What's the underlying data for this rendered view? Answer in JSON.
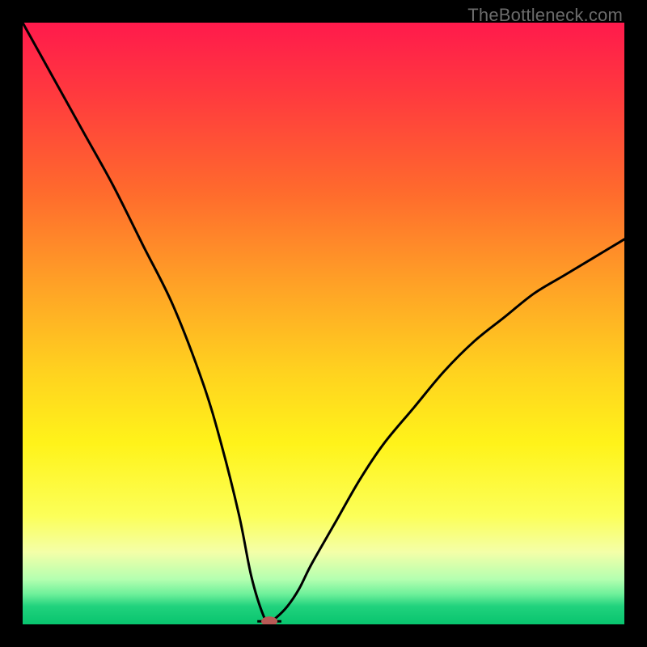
{
  "watermark": "TheBottleneck.com",
  "chart_data": {
    "type": "line",
    "title": "",
    "xlabel": "",
    "ylabel": "",
    "xlim": [
      0,
      100
    ],
    "ylim": [
      0,
      100
    ],
    "series": [
      {
        "name": "bottleneck-curve",
        "x": [
          0,
          5,
          10,
          15,
          20,
          25,
          30,
          33,
          36,
          38,
          40,
          41,
          42,
          44,
          46,
          48,
          52,
          56,
          60,
          65,
          70,
          75,
          80,
          85,
          90,
          95,
          100
        ],
        "values": [
          100,
          91,
          82,
          73,
          63,
          53,
          40,
          30,
          18,
          8,
          1.5,
          0.5,
          1,
          3,
          6,
          10,
          17,
          24,
          30,
          36,
          42,
          47,
          51,
          55,
          58,
          61,
          64
        ]
      }
    ],
    "marker": {
      "x": 41,
      "y": 0.5,
      "color": "#b85a56"
    },
    "gradient_stops": [
      {
        "pos": 0,
        "color": "#ff1a4c"
      },
      {
        "pos": 0.7,
        "color": "#fff31a"
      },
      {
        "pos": 1.0,
        "color": "#08c46e"
      }
    ]
  }
}
